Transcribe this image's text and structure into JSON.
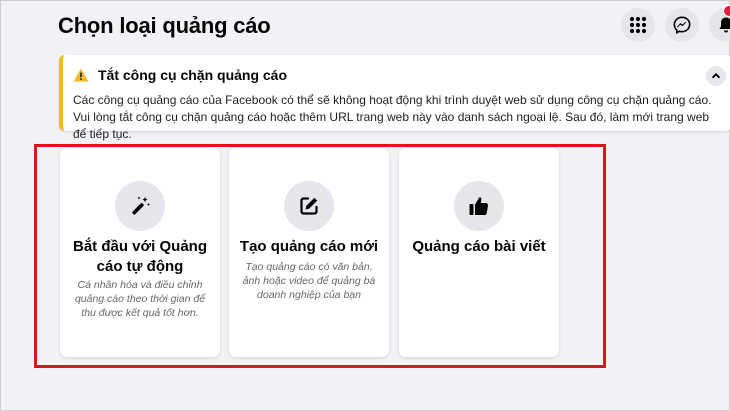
{
  "page": {
    "title": "Chọn loại quảng cáo"
  },
  "top_icons": [
    "menu-grid-icon",
    "messenger-icon",
    "bell-icon"
  ],
  "alert": {
    "title": "Tắt công cụ chặn quảng cáo",
    "body": "Các công cụ quảng cáo của Facebook có thể sẽ không hoạt động khi trình duyệt web sử dụng công cụ chặn quảng cáo. Vui lòng tắt công cụ chặn quảng cáo hoặc thêm URL trang web này vào danh sách ngoại lệ. Sau đó, làm mới trang web để tiếp tục.",
    "accent_color": "#f7b928"
  },
  "cards": [
    {
      "icon": "magic-wand-icon",
      "title": "Bắt đầu với Quảng cáo tự động",
      "description": "Cá nhân hóa và điều chỉnh quảng cáo theo thời gian để thu được kết quả tốt hơn."
    },
    {
      "icon": "edit-icon",
      "title": "Tạo quảng cáo mới",
      "description": "Tạo quảng cáo có văn bản, ảnh hoặc video để quảng bá doanh nghiệp của bạn"
    },
    {
      "icon": "thumbs-up-icon",
      "title": "Quảng cáo bài viết",
      "description": ""
    }
  ],
  "colors": {
    "background": "#f0f2f5",
    "highlight_frame": "#e0151c",
    "notification": "#e41e3f"
  }
}
